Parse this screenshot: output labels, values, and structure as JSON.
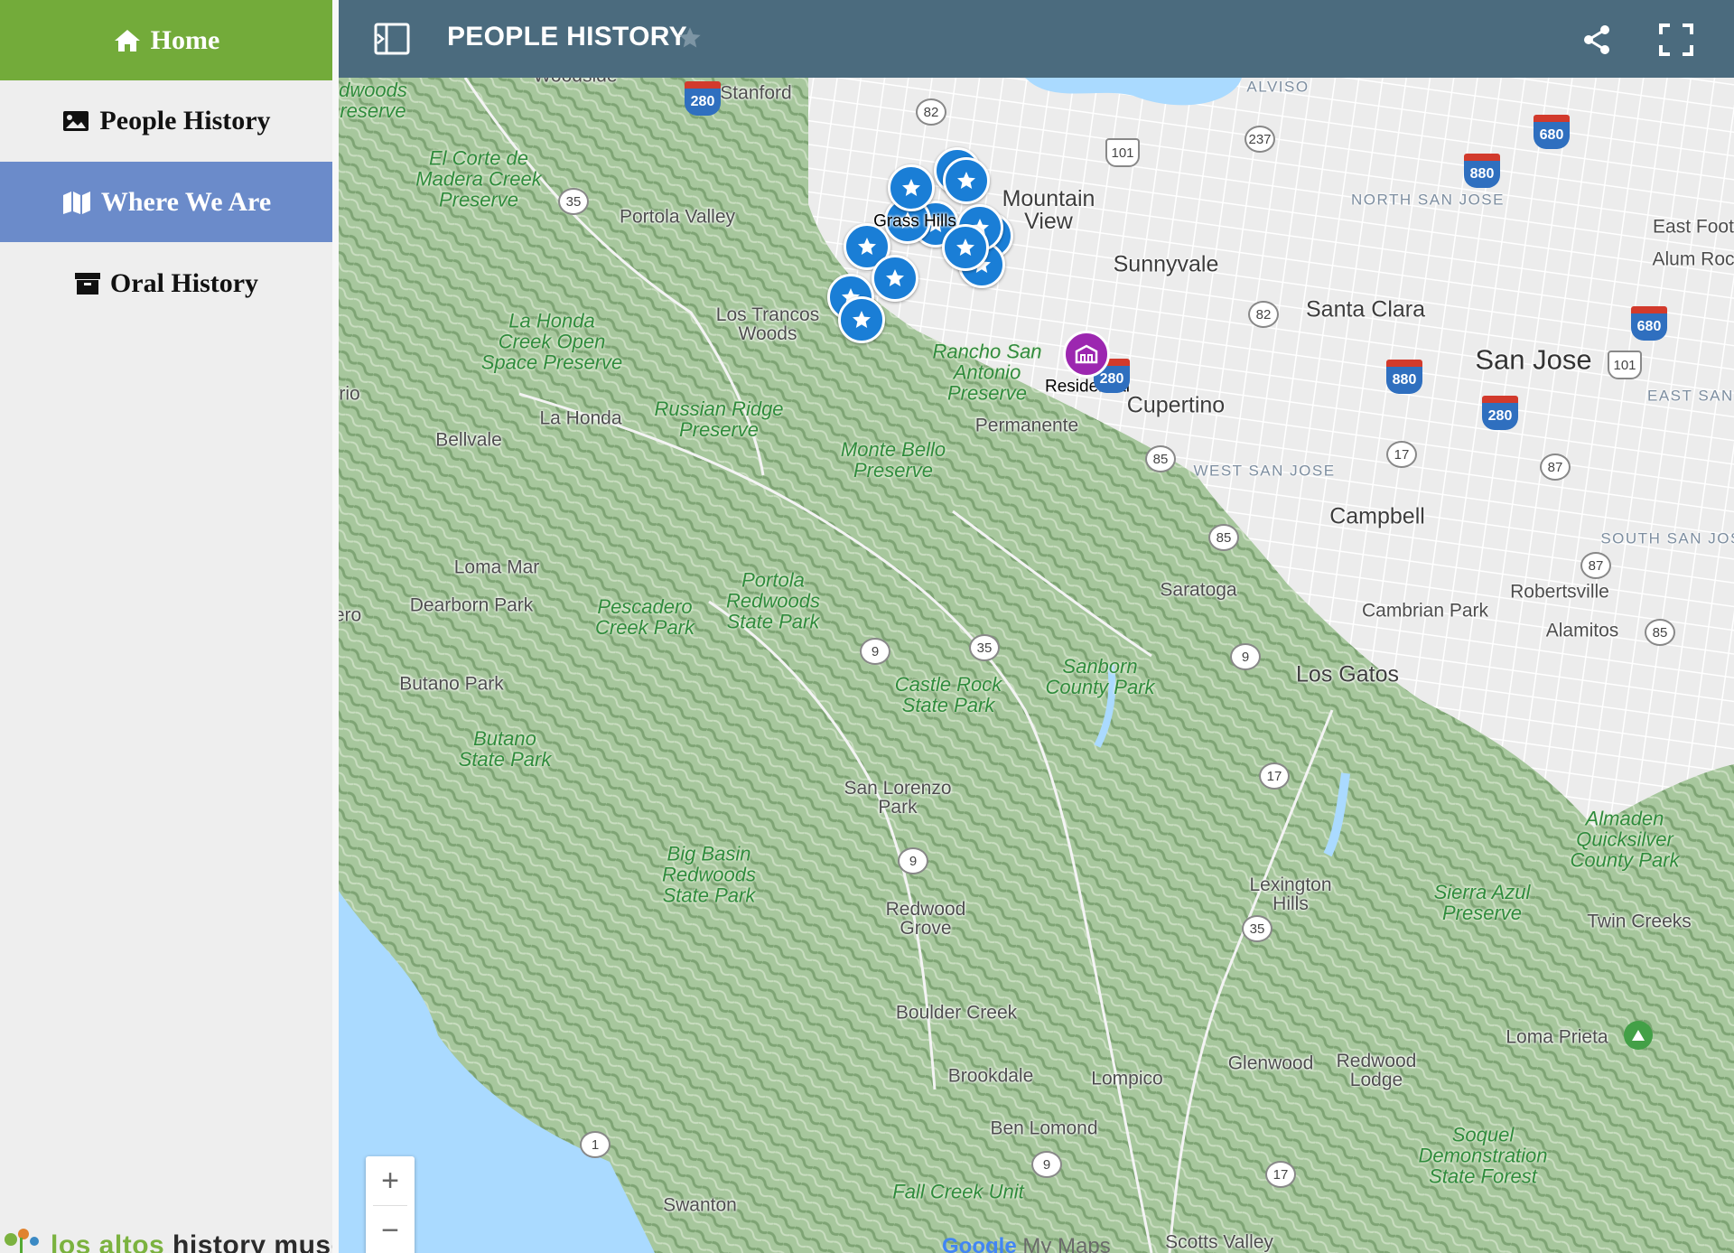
{
  "sidebar": {
    "items": [
      {
        "label": "Home",
        "icon": "home-icon"
      },
      {
        "label": "People History",
        "icon": "image-icon"
      },
      {
        "label": "Where We Are",
        "icon": "map-icon"
      },
      {
        "label": "Oral History",
        "icon": "archive-icon"
      }
    ],
    "active": "Where We Are",
    "footer_logo_text_1": "los altos",
    "footer_logo_text_2": " history museum"
  },
  "header": {
    "title": "PEOPLE HISTORY",
    "icons": [
      "sidebar-toggle-icon",
      "star-icon",
      "share-icon",
      "fullscreen-icon"
    ]
  },
  "map": {
    "places": {
      "woodside": "Woodside",
      "stanford": "Stanford",
      "alviso": "ALVISO",
      "redwoods": "dwoods\nreserve",
      "el_corte": "El Corte de\nMadera Creek\nPreserve",
      "portola_valley": "Portola Valley",
      "mountain_view": "Mountain\nView",
      "north_san_jose": "NORTH SAN JOSE",
      "east_foothills": "East Foot",
      "alum_rock": "Alum Roc",
      "sunnyvale": "Sunnyvale",
      "santa_clara": "Santa Clara",
      "san_jose": "San Jose",
      "east_san_jose": "EAST SAN J",
      "la_honda_creek": "La Honda\nCreek Open\nSpace Preserve",
      "los_trancos": "Los Trancos\nWoods",
      "rancho": "Rancho San\nAntonio\nPreserve",
      "residential": "Residential",
      "cupertino": "Cupertino",
      "russian_ridge": "Russian Ridge\nPreserve",
      "la_honda": "La Honda",
      "permanente": "Permanente",
      "bellvale": "Bellvale",
      "rio": "rio",
      "monte_bello": "Monte Bello\nPreserve",
      "west_san_jose": "WEST SAN JOSE",
      "campbell": "Campbell",
      "south_san_jose": "SOUTH SAN JOSE",
      "loma_mar": "Loma Mar",
      "portola_redwoods": "Portola\nRedwoods\nState Park",
      "dearborn_park": "Dearborn Park",
      "pescadero_creek": "Pescadero\nCreek Park",
      "saratoga": "Saratoga",
      "robertsville": "Robertsville",
      "cambrian_park": "Cambrian Park",
      "ero": "ero",
      "alamitos": "Alamitos",
      "los_gatos": "Los Gatos",
      "castle_rock": "Castle Rock\nState Park",
      "sanborn": "Sanborn\nCounty Park",
      "butano_park": "Butano Park",
      "butano_state_park": "Butano\nState Park",
      "san_lorenzo_park": "San Lorenzo\nPark",
      "almaden": "Almaden\nQuicksilver\nCounty Park",
      "big_basin": "Big Basin\nRedwoods\nState Park",
      "lexington_hills": "Lexington\nHills",
      "sierra_azul": "Sierra Azul\nPreserve",
      "twin_creeks": "Twin Creeks",
      "redwood_grove": "Redwood\nGrove",
      "boulder_creek": "Boulder Creek",
      "loma_prieta": "Loma Prieta",
      "brookdale": "Brookdale",
      "lompico": "Lompico",
      "glenwood": "Glenwood",
      "redwood_lodge": "Redwood\nLodge",
      "ben_lomond": "Ben Lomond",
      "soquel": "Soquel\nDemonstration\nState Forest",
      "fall_creek": "Fall Creek Unit",
      "swanton": "Swanton",
      "scotts_valley": "Scotts Valley",
      "grass_hills": "Grass Hills"
    },
    "highway_shields": {
      "i280_a": "280",
      "s82_a": "82",
      "s237": "237",
      "us101_a": "101",
      "i680_a": "680",
      "i880_a": "880",
      "s35_a": "35",
      "s82_b": "82",
      "i680_b": "680",
      "i880_b": "880",
      "us101_b": "101",
      "i280_b": "280",
      "i280_c": "280",
      "s85_a": "85",
      "s17_a": "17",
      "s87_a": "87",
      "s85_b": "85",
      "s87_b": "87",
      "s85_c": "85",
      "s9_a": "9",
      "s35_b": "35",
      "s9_b": "9",
      "s17_b": "17",
      "s9_c": "9",
      "s35_c": "35",
      "s1": "1",
      "s9_d": "9",
      "s17_c": "17"
    },
    "zoom_in": "+",
    "zoom_out": "−",
    "attribution_google": "Google",
    "attribution_my_maps": " My Maps"
  },
  "colors": {
    "home_bg": "#73ab3a",
    "active_nav_bg": "#6b8bca",
    "header_bg": "#4b6b7e",
    "marker_blue": "#1a7ed6",
    "marker_purple": "#9c27b0",
    "terrain_green": "#8fb88a",
    "water": "#aadaff"
  }
}
